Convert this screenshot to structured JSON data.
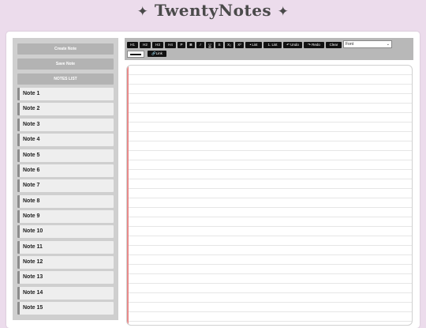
{
  "app": {
    "title": "TwentyNotes",
    "star_left": "✦",
    "star_right": "✦"
  },
  "sidebar": {
    "create_label": "Create Note",
    "save_label": "Save Note",
    "list_label": "NOTES LIST",
    "notes": [
      "Note 1",
      "Note 2",
      "Note 3",
      "Note 4",
      "Note 5",
      "Note 6",
      "Note 7",
      "Note 8",
      "Note 9",
      "Note 10",
      "Note 11",
      "Note 12",
      "Note 13",
      "Note 14",
      "Note 15"
    ]
  },
  "toolbar": {
    "h1": "H1",
    "h2": "H2",
    "h3": "H3",
    "h4": "H4",
    "p": "P",
    "bold": "B",
    "italic": "I",
    "underline": "U",
    "strike": "S",
    "subscript": "X₂",
    "superscript": "X²",
    "bullet_list": "• List",
    "numbered_list": "1. List",
    "undo": "↶ Undo",
    "redo": "↷ Redo",
    "clear": "Clear",
    "font_select_value": "Font",
    "link": "🔗Link",
    "text_color": "#111111"
  },
  "colors": {
    "background": "#ecdcec",
    "sidebar": "#cfcfcf",
    "toolbar": "#b8b8b8",
    "margin_line": "#e88a8a"
  }
}
